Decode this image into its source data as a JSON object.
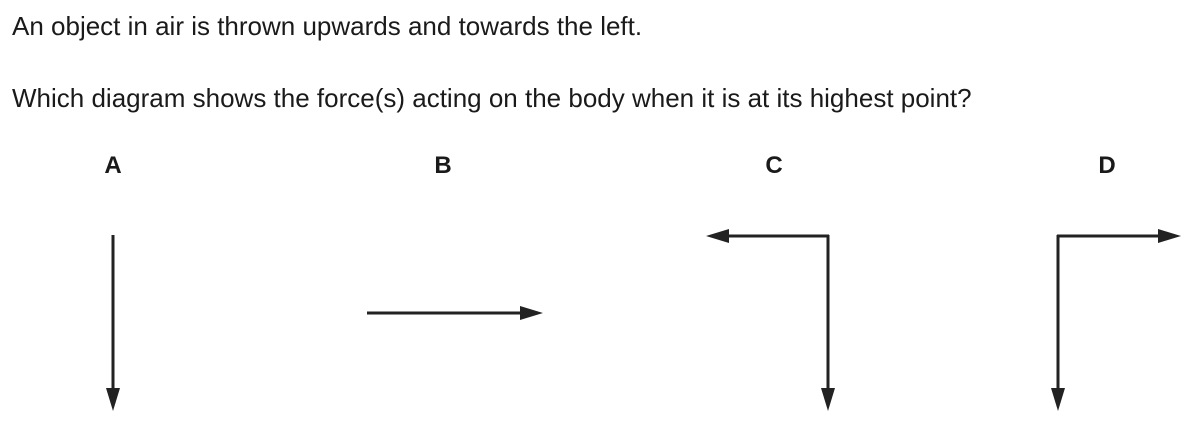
{
  "question": {
    "line1": "An object in air is thrown upwards and towards the left.",
    "line2": "Which diagram shows the force(s) acting on the body when it is at its highest point?"
  },
  "options": {
    "a": {
      "label": "A",
      "arrows": [
        "down"
      ]
    },
    "b": {
      "label": "B",
      "arrows": [
        "right"
      ]
    },
    "c": {
      "label": "C",
      "arrows": [
        "left",
        "down"
      ]
    },
    "d": {
      "label": "D",
      "arrows": [
        "right",
        "down"
      ]
    }
  },
  "colors": {
    "text": "#1a1a1a",
    "arrow": "#222222"
  }
}
